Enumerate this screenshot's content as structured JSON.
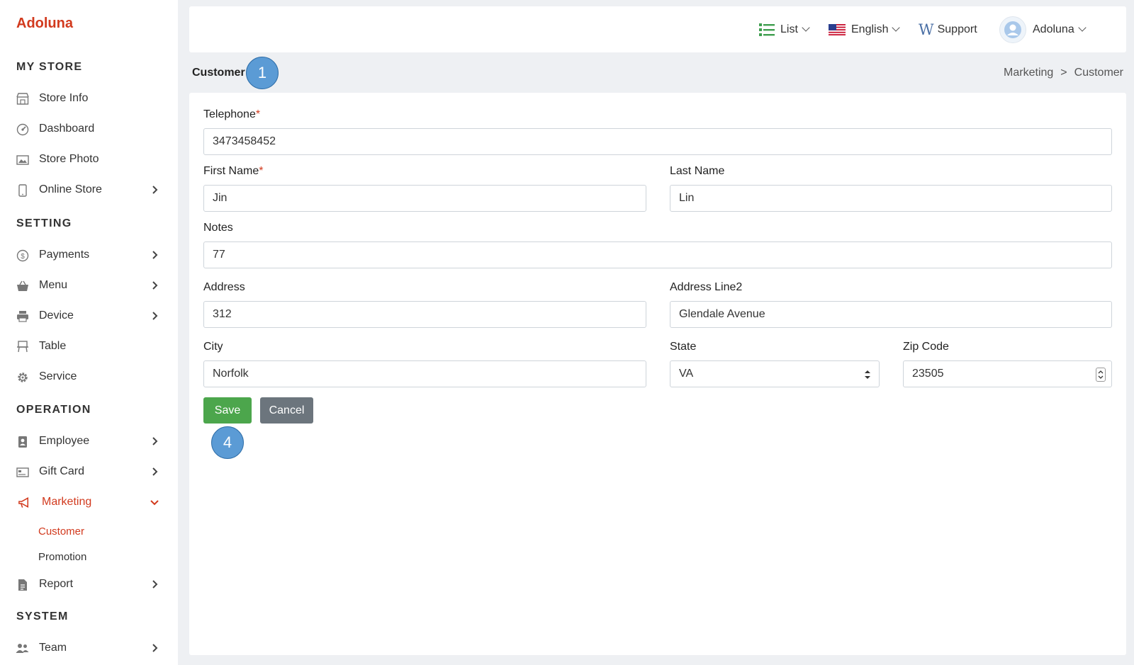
{
  "brand": "Adoluna",
  "sidebar": {
    "sections": {
      "my_store": "MY STORE",
      "setting": "SETTING",
      "operation": "OPERATION",
      "system": "SYSTEM"
    },
    "items": {
      "store_info": "Store Info",
      "dashboard": "Dashboard",
      "store_photo": "Store Photo",
      "online_store": "Online Store",
      "payments": "Payments",
      "menu": "Menu",
      "device": "Device",
      "table": "Table",
      "service": "Service",
      "employee": "Employee",
      "gift_card": "Gift Card",
      "marketing": "Marketing",
      "customer": "Customer",
      "promotion": "Promotion",
      "report": "Report",
      "team": "Team"
    }
  },
  "topbar": {
    "view": "List",
    "language": "English",
    "support": "Support",
    "user": "Adoluna"
  },
  "page": {
    "title": "Customer",
    "breadcrumb": [
      "Marketing",
      ">",
      "Customer"
    ]
  },
  "annotations": {
    "first": "1",
    "second": "4"
  },
  "form": {
    "telephone": {
      "label": "Telephone",
      "required": "*",
      "value": "3473458452"
    },
    "first_name": {
      "label": "First Name",
      "required": "*",
      "value": "Jin"
    },
    "last_name": {
      "label": "Last Name",
      "value": "Lin"
    },
    "notes": {
      "label": "Notes",
      "value": "77"
    },
    "address": {
      "label": "Address",
      "value": "312"
    },
    "address2": {
      "label": "Address Line2",
      "value": "Glendale Avenue"
    },
    "city": {
      "label": "City",
      "value": "Norfolk"
    },
    "state": {
      "label": "State",
      "value": "VA"
    },
    "zip": {
      "label": "Zip Code",
      "value": "23505"
    }
  },
  "buttons": {
    "save": "Save",
    "cancel": "Cancel"
  },
  "colors": {
    "brand": "#d23a1e",
    "save": "#4ca64c",
    "cancel": "#6c757d",
    "badge": "#5b9bd5"
  }
}
